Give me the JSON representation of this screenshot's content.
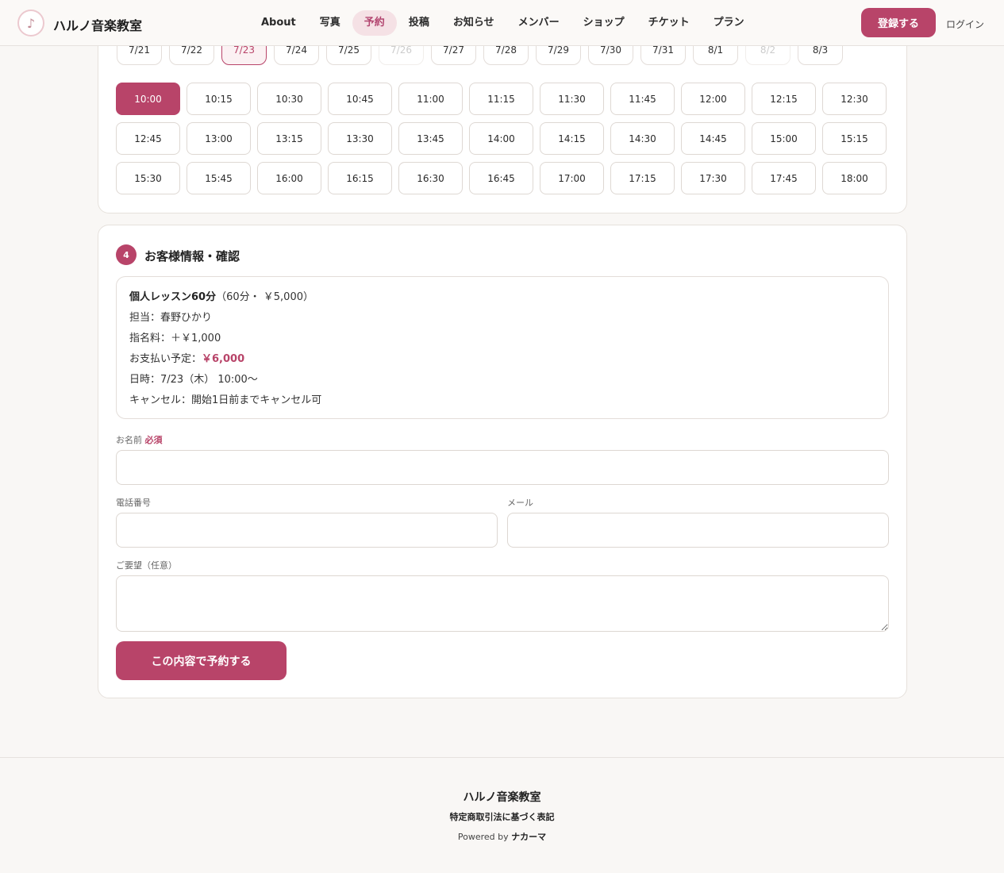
{
  "header": {
    "logo_glyph": "♪",
    "site_name": "ハルノ音楽教室",
    "nav": [
      {
        "label": "About"
      },
      {
        "label": "写真"
      },
      {
        "label": "予約",
        "active": true
      },
      {
        "label": "投稿"
      },
      {
        "label": "お知らせ"
      },
      {
        "label": "メンバー"
      },
      {
        "label": "ショップ"
      },
      {
        "label": "チケット"
      },
      {
        "label": "プラン"
      }
    ],
    "register_label": "登録する",
    "login_label": "ログイン"
  },
  "dates": [
    {
      "label": "7/21"
    },
    {
      "label": "7/22"
    },
    {
      "label": "7/23",
      "selected": true
    },
    {
      "label": "7/24"
    },
    {
      "label": "7/25"
    },
    {
      "label": "7/26",
      "disabled": true
    },
    {
      "label": "7/27"
    },
    {
      "label": "7/28"
    },
    {
      "label": "7/29"
    },
    {
      "label": "7/30"
    },
    {
      "label": "7/31"
    },
    {
      "label": "8/1"
    },
    {
      "label": "8/2",
      "disabled": true
    },
    {
      "label": "8/3"
    }
  ],
  "times": [
    "10:00",
    "10:15",
    "10:30",
    "10:45",
    "11:00",
    "11:15",
    "11:30",
    "11:45",
    "12:00",
    "12:15",
    "12:30",
    "12:45",
    "13:00",
    "13:15",
    "13:30",
    "13:45",
    "14:00",
    "14:15",
    "14:30",
    "14:45",
    "15:00",
    "15:15",
    "15:30",
    "15:45",
    "16:00",
    "16:15",
    "16:30",
    "16:45",
    "17:00",
    "17:15",
    "17:30",
    "17:45",
    "18:00"
  ],
  "selected_time": "10:00",
  "confirm": {
    "step_number": "4",
    "title": "お客様情報・確認",
    "course_name": "個人レッスン60分",
    "course_detail": "（60分・ ￥5,000）",
    "teacher_line": "担当：春野ひかり",
    "fee_line": "指名料：＋￥1,000",
    "payment_label": "お支払い予定：",
    "payment_value": "￥6,000",
    "datetime_line": "日時：7/23（木） 10:00〜",
    "cancel_line": "キャンセル：開始1日前までキャンセル可"
  },
  "form": {
    "name_label": "お名前",
    "required_label": "必須",
    "name_value": "",
    "phone_label": "電話番号",
    "phone_value": "",
    "email_label": "メール",
    "email_value": "",
    "request_label": "ご要望（任意）",
    "request_value": "",
    "submit_label": "この内容で予約する"
  },
  "footer": {
    "site_name": "ハルノ音楽教室",
    "legal_link": "特定商取引法に基づく表記",
    "powered_prefix": "Powered by",
    "powered_brand": "ナカーマ"
  },
  "colors": {
    "accent": "#b84469",
    "accent_light": "#f5e1e5",
    "background": "#f9f7f5"
  }
}
